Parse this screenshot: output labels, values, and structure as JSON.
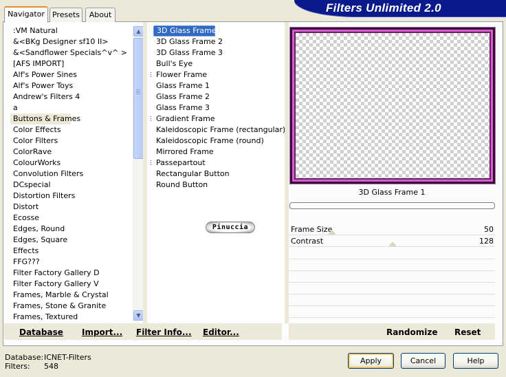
{
  "window": {
    "title": "Filters Unlimited 2.0"
  },
  "tabs": [
    {
      "label": "Navigator",
      "active": true
    },
    {
      "label": "Presets",
      "active": false
    },
    {
      "label": "About",
      "active": false
    }
  ],
  "categories": [
    ":VM Natural",
    "&<BKg Designer sf10 II>",
    "&<Sandflower Specials^v^ >",
    "[AFS IMPORT]",
    "Alf's Power Sines",
    "Alf's Power Toys",
    "Andrew's Filters 4",
    "a",
    "Buttons & Frames",
    "Color Effects",
    "Color Filters",
    "ColorRave",
    "ColourWorks",
    "Convolution Filters",
    "DCspecial",
    "Distortion Filters",
    "Distort",
    "Ecosse",
    "Edges, Round",
    "Edges, Square",
    "Effects",
    "FFG???",
    "Filter Factory Gallery D",
    "Filter Factory Gallery V",
    "Frames, Marble & Crystal",
    "Frames, Stone & Granite",
    "Frames, Textured"
  ],
  "selected_category": "Buttons & Frames",
  "filters": [
    {
      "label": "3D Glass Frame 1",
      "expander": false
    },
    {
      "label": "3D Glass Frame 2",
      "expander": false
    },
    {
      "label": "3D Glass Frame 3",
      "expander": false
    },
    {
      "label": "Bull's Eye",
      "expander": false
    },
    {
      "label": "Flower Frame",
      "expander": true
    },
    {
      "label": "Glass Frame 1",
      "expander": false
    },
    {
      "label": "Glass Frame 2",
      "expander": false
    },
    {
      "label": "Glass Frame 3",
      "expander": false
    },
    {
      "label": "Gradient Frame",
      "expander": true
    },
    {
      "label": "Kaleidoscopic Frame (rectangular)",
      "expander": false
    },
    {
      "label": "Kaleidoscopic Frame (round)",
      "expander": false
    },
    {
      "label": "Mirrored Frame",
      "expander": false
    },
    {
      "label": "Passepartout",
      "expander": true
    },
    {
      "label": "Rectangular Button",
      "expander": false
    },
    {
      "label": "Round Button",
      "expander": false
    }
  ],
  "selected_filter": "3D Glass Frame 1",
  "logo_text": "Pinuccia",
  "preview": {
    "filter_name": "3D Glass Frame 1",
    "progress": 0
  },
  "params": [
    {
      "label": "Frame Size",
      "value": "50",
      "max": 255
    },
    {
      "label": "Contrast",
      "value": "128",
      "max": 255
    }
  ],
  "toolbar": {
    "database": "Database",
    "import": "Import...",
    "filter_info": "Filter Info...",
    "editor": "Editor...",
    "randomize": "Randomize",
    "reset": "Reset"
  },
  "status": {
    "database_label": "Database:",
    "database_value": "ICNET-Filters",
    "filters_label": "Filters:",
    "filters_value": "548"
  },
  "buttons": {
    "apply": "Apply",
    "cancel": "Cancel",
    "help": "Help"
  },
  "colors": {
    "banner": "#0a1a8a",
    "selection": "#316ac5",
    "frame_pink": "#d55fd0"
  },
  "icons": [
    "scroll-up-icon",
    "scroll-down-icon",
    "expander-icon"
  ]
}
